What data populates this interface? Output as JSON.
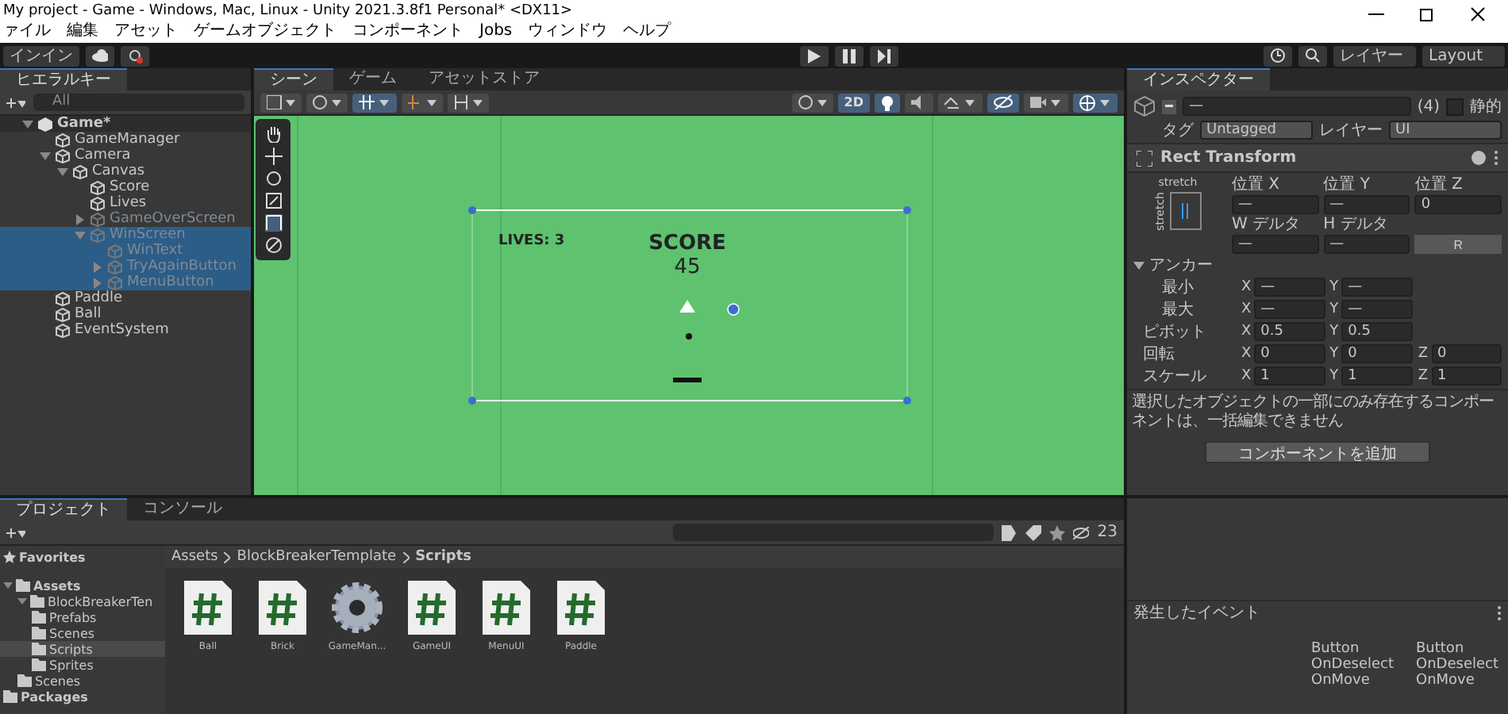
{
  "window": {
    "title": "My project - Game - Windows, Mac, Linux - Unity 2021.3.8f1 Personal* <DX11>"
  },
  "menu": [
    "ァイル",
    "編集",
    "アセット",
    "ゲームオブジェクト",
    "コンポーネント",
    "Jobs",
    "ウィンドウ",
    "ヘルプ"
  ],
  "toolbar": {
    "account": "インイン",
    "layers": "レイヤー",
    "layout": "Layout"
  },
  "hierarchy": {
    "tab": "ヒエラルキー",
    "search": "All",
    "items": [
      {
        "label": "Game*",
        "kind": "scene",
        "expanded": true,
        "active": true,
        "selected": false,
        "children": [
          {
            "label": "GameManager",
            "kind": "object",
            "active": true,
            "selected": false
          },
          {
            "label": "Camera",
            "kind": "object",
            "expanded": true,
            "active": true,
            "selected": false,
            "children": [
              {
                "label": "Canvas",
                "kind": "object",
                "expanded": true,
                "active": true,
                "selected": false,
                "children": [
                  {
                    "label": "Score",
                    "kind": "object",
                    "active": true,
                    "selected": false
                  },
                  {
                    "label": "Lives",
                    "kind": "object",
                    "active": true,
                    "selected": false
                  },
                  {
                    "label": "GameOverScreen",
                    "kind": "object",
                    "expanded": false,
                    "active": false,
                    "selected": false
                  },
                  {
                    "label": "WinScreen",
                    "kind": "object",
                    "expanded": true,
                    "active": false,
                    "selected": true,
                    "children": [
                      {
                        "label": "WinText",
                        "kind": "object",
                        "active": false,
                        "selected": true
                      },
                      {
                        "label": "TryAgainButton",
                        "kind": "object",
                        "expanded": false,
                        "active": false,
                        "selected": true
                      },
                      {
                        "label": "MenuButton",
                        "kind": "object",
                        "expanded": false,
                        "active": false,
                        "selected": true
                      }
                    ]
                  }
                ]
              }
            ]
          },
          {
            "label": "Paddle",
            "kind": "object",
            "active": true,
            "selected": false
          },
          {
            "label": "Ball",
            "kind": "object",
            "active": true,
            "selected": false
          },
          {
            "label": "EventSystem",
            "kind": "object",
            "active": true,
            "selected": false
          }
        ]
      }
    ]
  },
  "scene": {
    "tabs": [
      {
        "label": "シーン",
        "selected": true
      },
      {
        "label": "ゲーム",
        "selected": false
      },
      {
        "label": "アセットストア",
        "selected": false
      }
    ],
    "mode_2d": "2D",
    "game": {
      "lives": "LIVES: 3",
      "score_label": "SCORE",
      "score": "45"
    }
  },
  "inspector": {
    "tab": "インスペクター",
    "name": "—",
    "count": "(4)",
    "active_mixed": true,
    "static_label": "静的",
    "static": false,
    "tag_label": "タグ",
    "tag": "Untagged",
    "layer_label": "レイヤー",
    "layer": "UI",
    "component": "Rect Transform",
    "stretch_h": "stretch",
    "stretch_v": "stretch",
    "fields": [
      {
        "label": "位置 X",
        "value": "—"
      },
      {
        "label": "位置 Y",
        "value": "—"
      },
      {
        "label": "位置 Z",
        "value": "0"
      },
      {
        "label": "W デルタ",
        "value": "—"
      },
      {
        "label": "H デルタ",
        "value": "—"
      }
    ],
    "r_button": "R",
    "anchors": "アンカー",
    "rows": [
      {
        "label": "最小",
        "axes": [
          {
            "axis": "X",
            "value": "—"
          },
          {
            "axis": "Y",
            "value": "—"
          }
        ]
      },
      {
        "label": "最大",
        "axes": [
          {
            "axis": "X",
            "value": "—"
          },
          {
            "axis": "Y",
            "value": "—"
          }
        ]
      },
      {
        "label": "ピボット",
        "axes": [
          {
            "axis": "X",
            "value": "0.5"
          },
          {
            "axis": "Y",
            "value": "0.5"
          }
        ]
      },
      {
        "label": "回転",
        "axes": [
          {
            "axis": "X",
            "value": "0"
          },
          {
            "axis": "Y",
            "value": "0"
          },
          {
            "axis": "Z",
            "value": "0"
          }
        ]
      },
      {
        "label": "スケール",
        "axes": [
          {
            "axis": "X",
            "value": "1"
          },
          {
            "axis": "Y",
            "value": "1"
          },
          {
            "axis": "Z",
            "value": "1"
          }
        ]
      }
    ],
    "message": "選択したオブジェクトの一部にのみ存在するコンポーネントは、一括編集できません",
    "add_button": "コンポーネントを追加",
    "events_title": "発生したイベント",
    "events": [
      [
        "Button",
        "OnDeselect",
        "OnMove"
      ],
      [
        "Button",
        "OnDeselect",
        "OnMove"
      ]
    ]
  },
  "project": {
    "tabs": [
      {
        "label": "プロジェクト",
        "selected": true
      },
      {
        "label": "コンソール",
        "selected": false
      }
    ],
    "count": "23",
    "favorites": "Favorites",
    "tree": [
      {
        "label": "Assets",
        "expanded": true,
        "selected": false,
        "children": [
          {
            "label": "BlockBreakerTen",
            "expanded": true,
            "selected": false,
            "children": [
              {
                "label": "Prefabs",
                "selected": false
              },
              {
                "label": "Scenes",
                "selected": false
              },
              {
                "label": "Scripts",
                "selected": true
              },
              {
                "label": "Sprites",
                "selected": false
              }
            ]
          },
          {
            "label": "Scenes",
            "selected": false
          }
        ]
      },
      {
        "label": "Packages",
        "selected": false
      }
    ],
    "breadcrumb": [
      "Assets",
      "BlockBreakerTemplate",
      "Scripts"
    ],
    "files": [
      {
        "label": "Ball",
        "kind": "script"
      },
      {
        "label": "Brick",
        "kind": "script"
      },
      {
        "label": "GameMan...",
        "kind": "settings"
      },
      {
        "label": "GameUI",
        "kind": "script"
      },
      {
        "label": "MenuUI",
        "kind": "script"
      },
      {
        "label": "Paddle",
        "kind": "script"
      }
    ]
  }
}
